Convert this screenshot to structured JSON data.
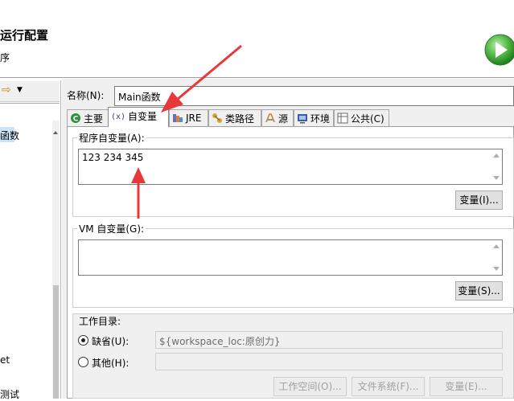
{
  "header": {
    "title": "运行配置",
    "subtitle": "序"
  },
  "left": {
    "toolbar_glyph": "⇨",
    "toolbar_dropdown": "▼",
    "tree_items": [
      "函数",
      "et",
      "测试"
    ]
  },
  "config": {
    "name_label": "名称(N):",
    "name_value": "Main函数"
  },
  "tabs": [
    {
      "label": "主要",
      "icon": "main-icon"
    },
    {
      "label": "自变量",
      "icon": "arguments-icon",
      "active": true
    },
    {
      "label": "JRE",
      "icon": "jre-icon"
    },
    {
      "label": "类路径",
      "icon": "classpath-icon"
    },
    {
      "label": "源",
      "icon": "source-icon"
    },
    {
      "label": "环境",
      "icon": "environment-icon"
    },
    {
      "label": "公共(C)",
      "icon": "common-icon"
    }
  ],
  "arguments": {
    "program_label": "程序自变量(A):",
    "program_value": "123 234 345",
    "program_vars_button": "变量(I)...",
    "vm_label": "VM 自变量(G):",
    "vm_value": "",
    "vm_vars_button": "变量(S)..."
  },
  "working_dir": {
    "label": "工作目录:",
    "default_label": "缺省(U):",
    "default_value": "${workspace_loc:原创力}",
    "other_label": "其他(H):",
    "other_value": "",
    "workspace_button": "工作空间(O)...",
    "filesystem_button": "文件系统(F)...",
    "variables_button": "变量(E)...",
    "selected": "default"
  },
  "colors": {
    "accent_arrow": "#e8393a",
    "run_icon": "#3aa63a",
    "selection": "#cce4f7"
  }
}
